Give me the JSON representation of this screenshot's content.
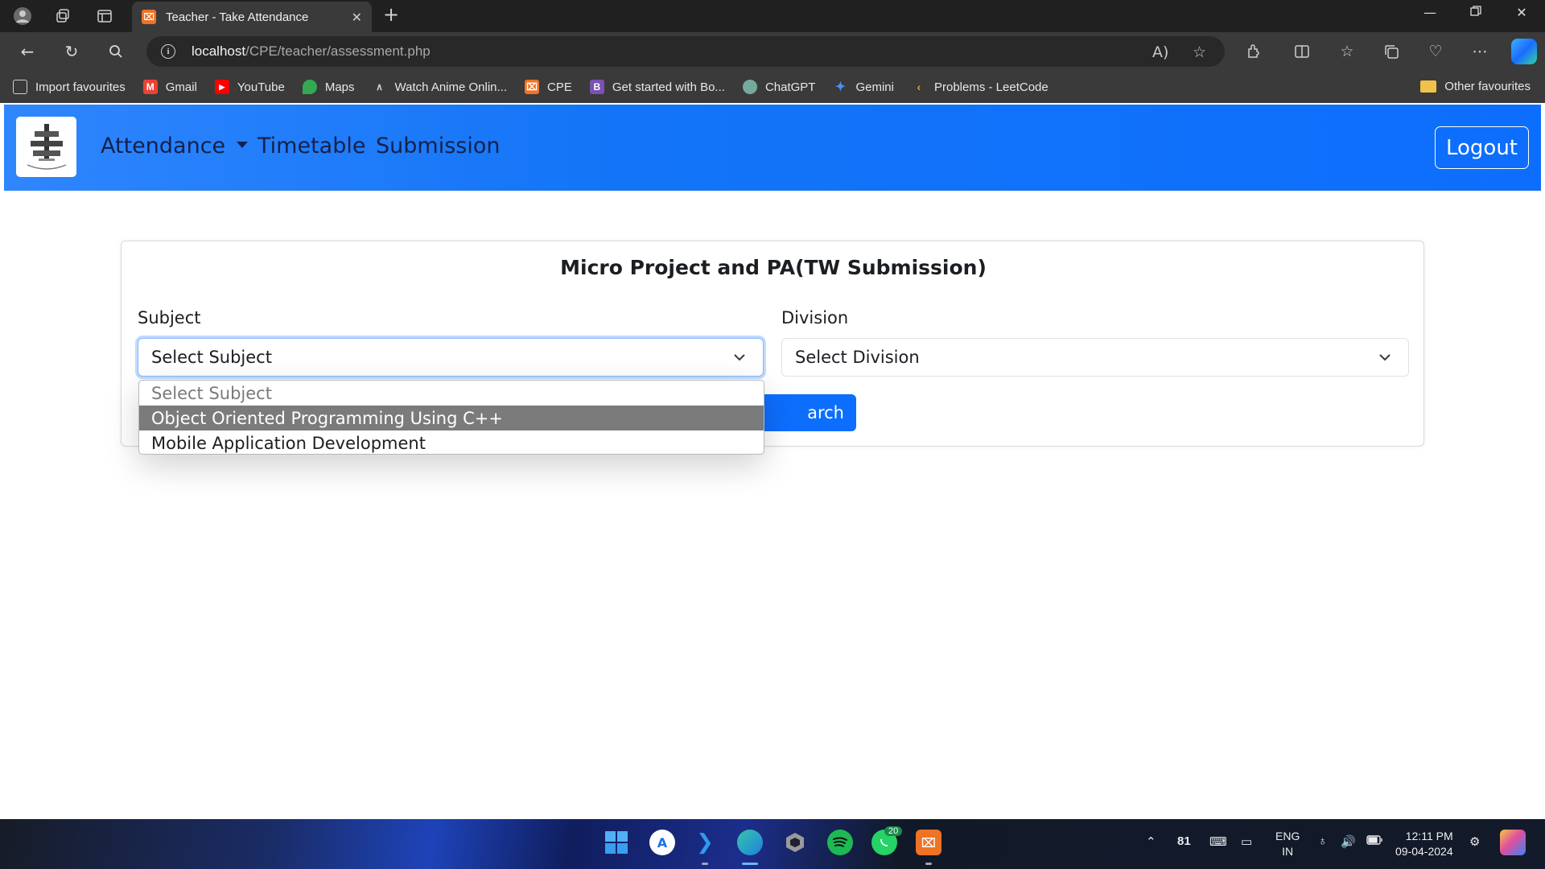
{
  "browser": {
    "tab_title": "Teacher - Take Attendance",
    "tab_favicon_letter": "⌧",
    "url_host": "localhost",
    "url_path": "/CPE/teacher/assessment.php",
    "bookmarks": [
      {
        "label": "Import favourites",
        "icon": "import-icon",
        "color": "#cfcfcf"
      },
      {
        "label": "Gmail",
        "icon": "gmail-icon",
        "color": "#ea4335"
      },
      {
        "label": "YouTube",
        "icon": "youtube-icon",
        "color": "#ff0000"
      },
      {
        "label": "Maps",
        "icon": "maps-icon",
        "color": "#34a853"
      },
      {
        "label": "Watch Anime Onlin...",
        "icon": "anime-icon",
        "color": "#cfcfcf"
      },
      {
        "label": "CPE",
        "icon": "xampp-icon",
        "color": "#ee7326"
      },
      {
        "label": "Get started with Bo...",
        "icon": "bootstrap-icon",
        "color": "#7952b3"
      },
      {
        "label": "ChatGPT",
        "icon": "chatgpt-icon",
        "color": "#74aa9c"
      },
      {
        "label": "Gemini",
        "icon": "gemini-icon",
        "color": "#4f8df5"
      },
      {
        "label": "Problems - LeetCode",
        "icon": "leetcode-icon",
        "color": "#f0a020"
      }
    ],
    "other_favourites": "Other favourites"
  },
  "app_nav": {
    "attendance": "Attendance",
    "timetable": "Timetable",
    "submission": "Submission",
    "logout": "Logout"
  },
  "card": {
    "title": "Micro Project and PA(TW Submission)",
    "subject_label": "Subject",
    "subject_value": "Select Subject",
    "division_label": "Division",
    "division_value": "Select Division",
    "search_button_visible": "arch"
  },
  "dropdown": {
    "options": [
      "Select Subject",
      "Object Oriented Programming Using C++",
      "Mobile Application Development"
    ],
    "highlighted_index": 1
  },
  "taskbar": {
    "whatsapp_badge": "20",
    "tray_number": "81",
    "lang_line1": "ENG",
    "lang_line2": "IN",
    "time": "12:11 PM",
    "date": "09-04-2024"
  }
}
